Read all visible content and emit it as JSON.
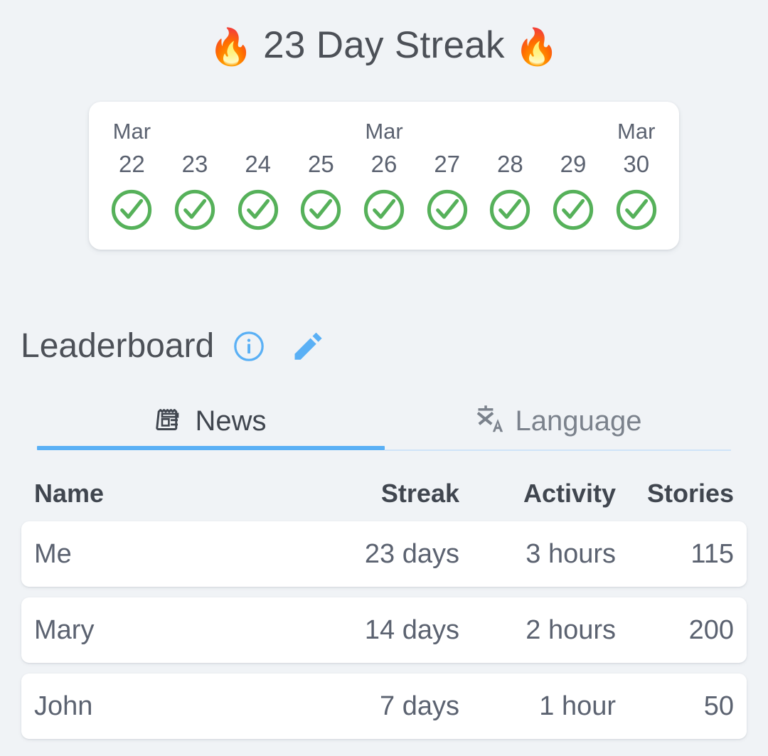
{
  "streak": {
    "flame_icon_left": "fire-icon",
    "flame_icon_right": "fire-icon",
    "flame_glyph": "🔥",
    "title": "23 Day Streak",
    "days": [
      {
        "month": "Mar",
        "show_month": true,
        "day": "22",
        "status": "check"
      },
      {
        "month": "Mar",
        "show_month": false,
        "day": "23",
        "status": "check"
      },
      {
        "month": "Mar",
        "show_month": false,
        "day": "24",
        "status": "check"
      },
      {
        "month": "Mar",
        "show_month": false,
        "day": "25",
        "status": "check"
      },
      {
        "month": "Mar",
        "show_month": true,
        "day": "26",
        "status": "check"
      },
      {
        "month": "Mar",
        "show_month": false,
        "day": "27",
        "status": "check"
      },
      {
        "month": "Mar",
        "show_month": false,
        "day": "28",
        "status": "check"
      },
      {
        "month": "Mar",
        "show_month": false,
        "day": "29",
        "status": "check"
      },
      {
        "month": "Mar",
        "show_month": true,
        "day": "30",
        "status": "check"
      }
    ]
  },
  "leaderboard": {
    "title": "Leaderboard",
    "info_icon": "info-circle-icon",
    "edit_icon": "pencil-icon",
    "tabs": [
      {
        "label": "News",
        "icon": "newspaper-icon",
        "active": true
      },
      {
        "label": "Language",
        "icon": "translate-icon",
        "active": false
      }
    ],
    "columns": [
      "Name",
      "Streak",
      "Activity",
      "Stories"
    ],
    "rows": [
      {
        "name": "Me",
        "streak": "23 days",
        "activity": "3 hours",
        "stories": "115"
      },
      {
        "name": "Mary",
        "streak": "14 days",
        "activity": "2 hours",
        "stories": "200"
      },
      {
        "name": "John",
        "streak": "7 days",
        "activity": "1 hour",
        "stories": "50"
      }
    ]
  },
  "colors": {
    "background": "#f0f3f6",
    "card": "#ffffff",
    "accent_blue": "#5ab0f5",
    "check_green": "#56b15a",
    "text_dark": "#4c5057",
    "text_muted": "#5b6270",
    "tab_inactive": "#7b828c"
  }
}
